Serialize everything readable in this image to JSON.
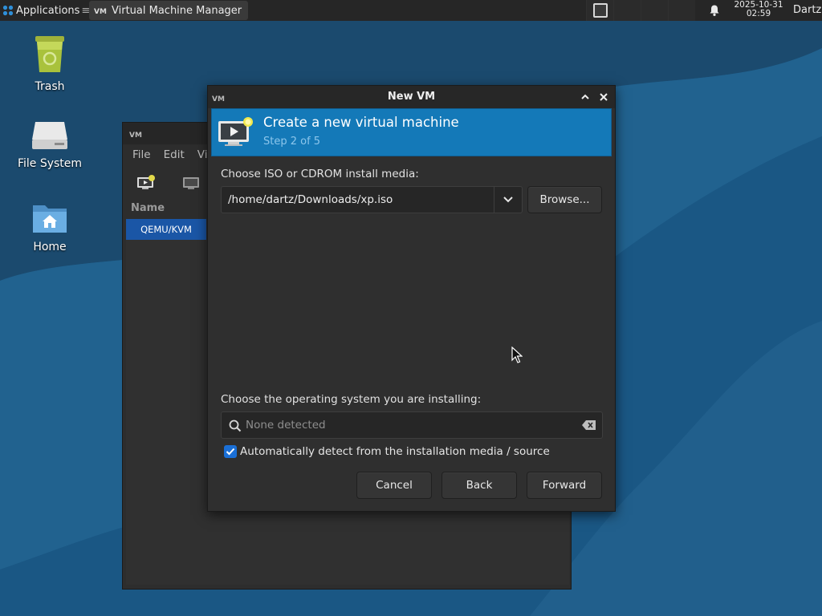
{
  "panel": {
    "applications_label": "Applications",
    "applications_sep": "≡",
    "task_label": "Virtual Machine Manager",
    "clock_date": "2025-10-31",
    "clock_time": "02:59",
    "user": "Dartz"
  },
  "desktop": {
    "icons": [
      {
        "label": "Trash",
        "icon": "trash-icon"
      },
      {
        "label": "File System",
        "icon": "drive-icon"
      },
      {
        "label": "Home",
        "icon": "home-folder-icon"
      }
    ]
  },
  "bg_window": {
    "menu": [
      "File",
      "Edit",
      "Vi"
    ],
    "column_header": "Name",
    "selected_row": "QEMU/KVM"
  },
  "dialog": {
    "title": "New VM",
    "header_title": "Create a new virtual machine",
    "header_step": "Step 2 of 5",
    "iso_label": "Choose ISO or CDROM install media:",
    "iso_value": "/home/dartz/Downloads/xp.iso",
    "browse_label": "Browse...",
    "os_label": "Choose the operating system you are installing:",
    "os_placeholder": "None detected",
    "auto_detect_label": "Automatically detect from the installation media / source",
    "auto_detect_checked": true,
    "cancel_label": "Cancel",
    "back_label": "Back",
    "forward_label": "Forward"
  },
  "colors": {
    "wallpaper": "#1d5680",
    "banner": "#1479b8",
    "selection": "#1a56a6",
    "checkbox": "#1a6fd6"
  }
}
